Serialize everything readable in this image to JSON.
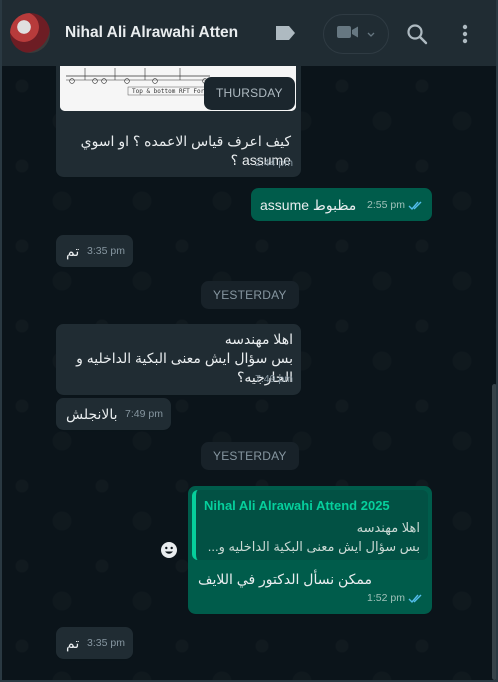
{
  "header": {
    "title": "Nihal Ali Alrawahi Atten",
    "icons": [
      "label-icon",
      "video-call-icon",
      "chevron-down-icon",
      "search-icon",
      "menu-icon"
    ]
  },
  "colors": {
    "header_bg": "#202c33",
    "chat_bg": "#0b141a",
    "incoming_bubble": "#202c33",
    "outgoing_bubble": "#005c4b",
    "quote_accent": "#06cf9c",
    "read_ticks": "#53bdeb"
  },
  "image_message": {
    "preview_text": "Top & bottom RFT For",
    "floating_date": "THURSDAY"
  },
  "messages": [
    {
      "id": "m1",
      "dir": "in",
      "text_line1": "كيف اعرف قياس الاعمده ؟ او اسوي",
      "text_line2": "assume ؟",
      "time": "2:44 pm"
    },
    {
      "id": "m2",
      "dir": "out",
      "text": "مظبوط  assume",
      "time": "2:55 pm"
    },
    {
      "id": "m3",
      "dir": "in",
      "text": "تم",
      "time": "3:35 pm"
    },
    {
      "id": "m4",
      "dir": "in",
      "text_line1": "اهلا مهندسه",
      "text_line2": "بس سؤال ايش معنى البكية الداخليه و",
      "text_line3": "الخارجيه؟",
      "time": "7:49 pm"
    },
    {
      "id": "m5",
      "dir": "in",
      "text": "بالانجلش",
      "time": "7:49 pm"
    },
    {
      "id": "m6",
      "dir": "out",
      "quote_author": "Nihal Ali Alrawahi Attend 2025",
      "quote_line1": "اهلا مهندسه",
      "quote_line2": "بس سؤال ايش معنى البكية الداخليه و...",
      "text": "ممكن نسأل الدكتور في اللايف",
      "time": "1:52 pm"
    },
    {
      "id": "m7",
      "dir": "in",
      "text": "تم",
      "time": "3:35 pm"
    }
  ],
  "date_separators": [
    "YESTERDAY",
    "YESTERDAY"
  ]
}
